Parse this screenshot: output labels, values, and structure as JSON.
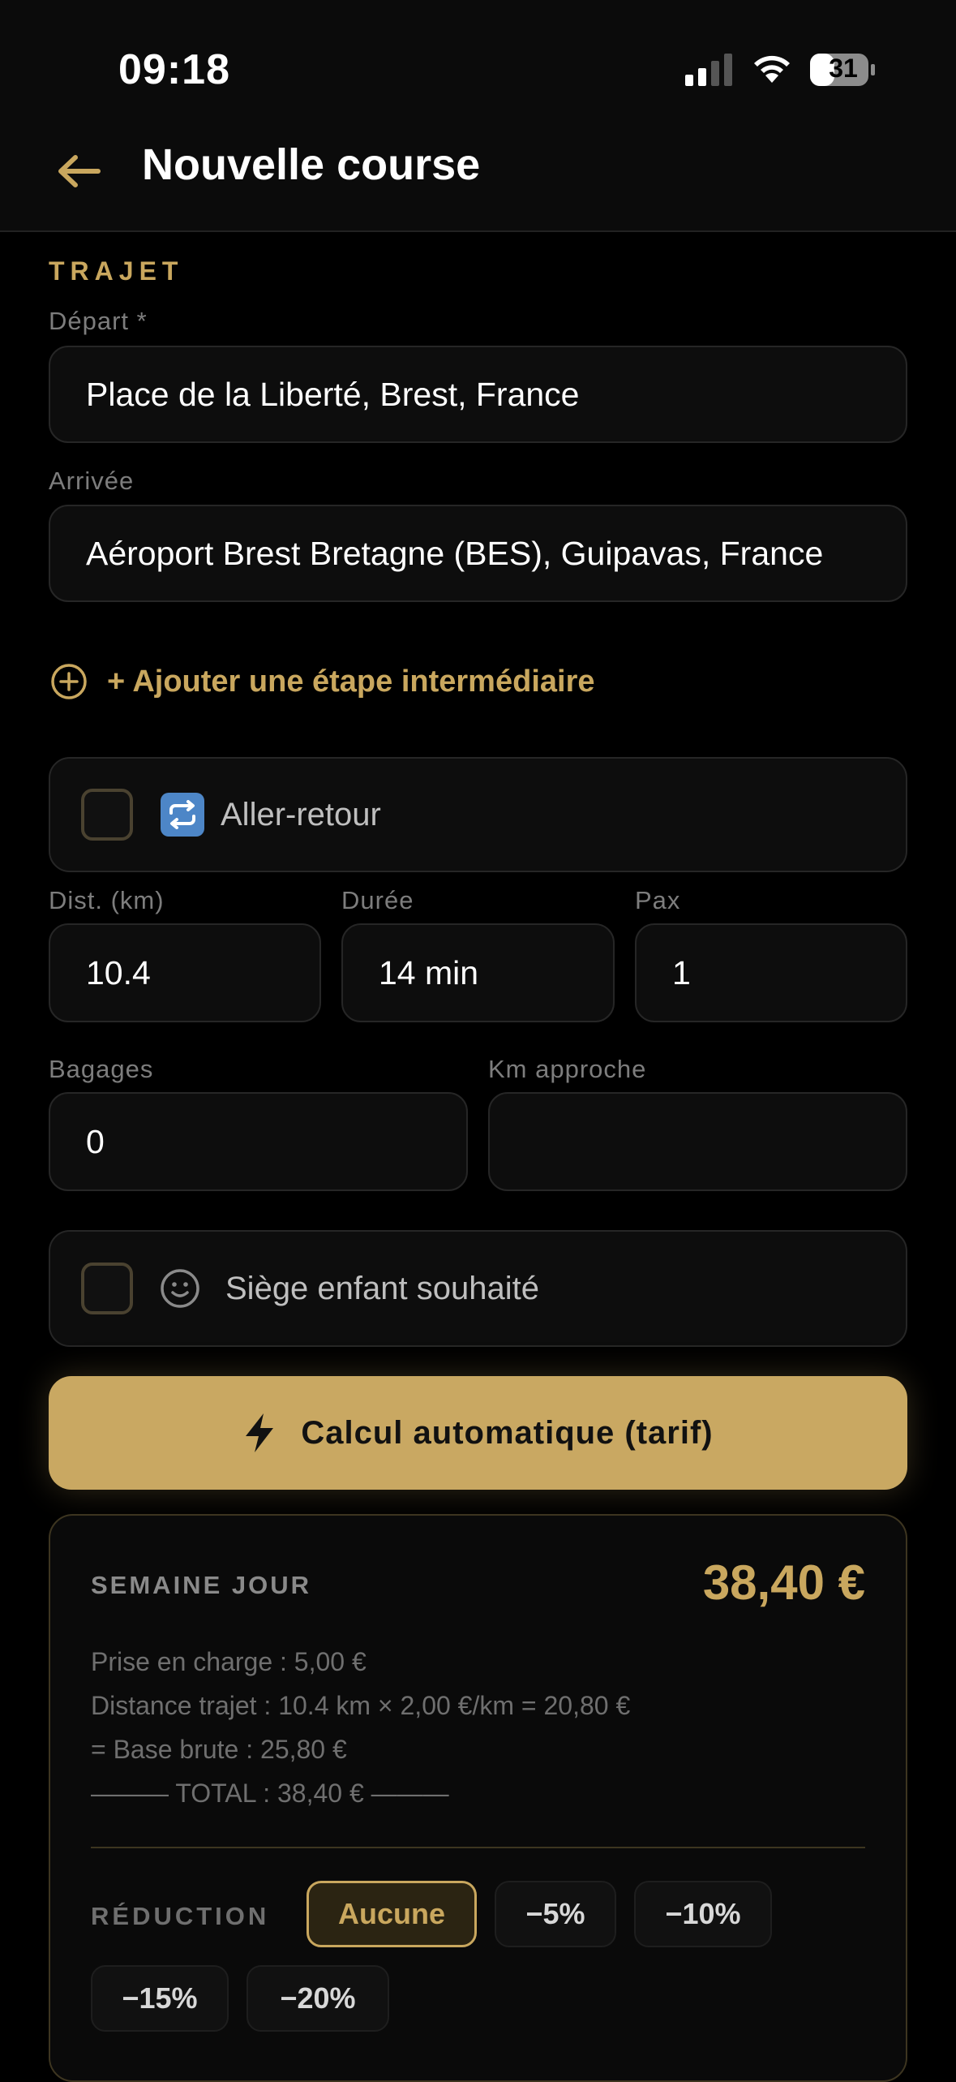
{
  "status_bar": {
    "time": "09:18",
    "battery": "31"
  },
  "header": {
    "title": "Nouvelle course"
  },
  "trajet": {
    "section_label": "TRAJET",
    "depart_label": "Départ *",
    "depart_value": "Place de la Liberté, Brest, France",
    "arrivee_label": "Arrivée",
    "arrivee_value": "Aéroport Brest Bretagne (BES), Guipavas, France",
    "add_step_label": "+ Ajouter une étape intermédiaire",
    "aller_retour_label": "Aller-retour"
  },
  "details": {
    "distance_label": "Dist. (km)",
    "distance_value": "10.4",
    "duree_label": "Durée",
    "duree_value": "14 min",
    "pax_label": "Pax",
    "pax_value": "1",
    "bagages_label": "Bagages",
    "bagages_value": "0",
    "km_approche_label": "Km approche",
    "km_approche_value": "",
    "siege_enfant_label": "Siège enfant souhaité"
  },
  "calc_button": {
    "label": "Calcul automatique (tarif)"
  },
  "tariff": {
    "name": "SEMAINE JOUR",
    "total": "38,40 €",
    "lines": [
      "Prise en charge : 5,00 €",
      "Distance trajet : 10.4 km × 2,00 €/km = 20,80 €",
      "= Base brute : 25,80 €",
      "——— TOTAL : 38,40 € ———"
    ],
    "reduction_label": "RÉDUCTION",
    "reductions": [
      "Aucune",
      "−5%",
      "−10%",
      "−15%",
      "−20%"
    ],
    "selected_reduction": "Aucune"
  },
  "colors": {
    "accent": "#c9a75e",
    "background": "#000000",
    "card": "#0d0d0d"
  }
}
